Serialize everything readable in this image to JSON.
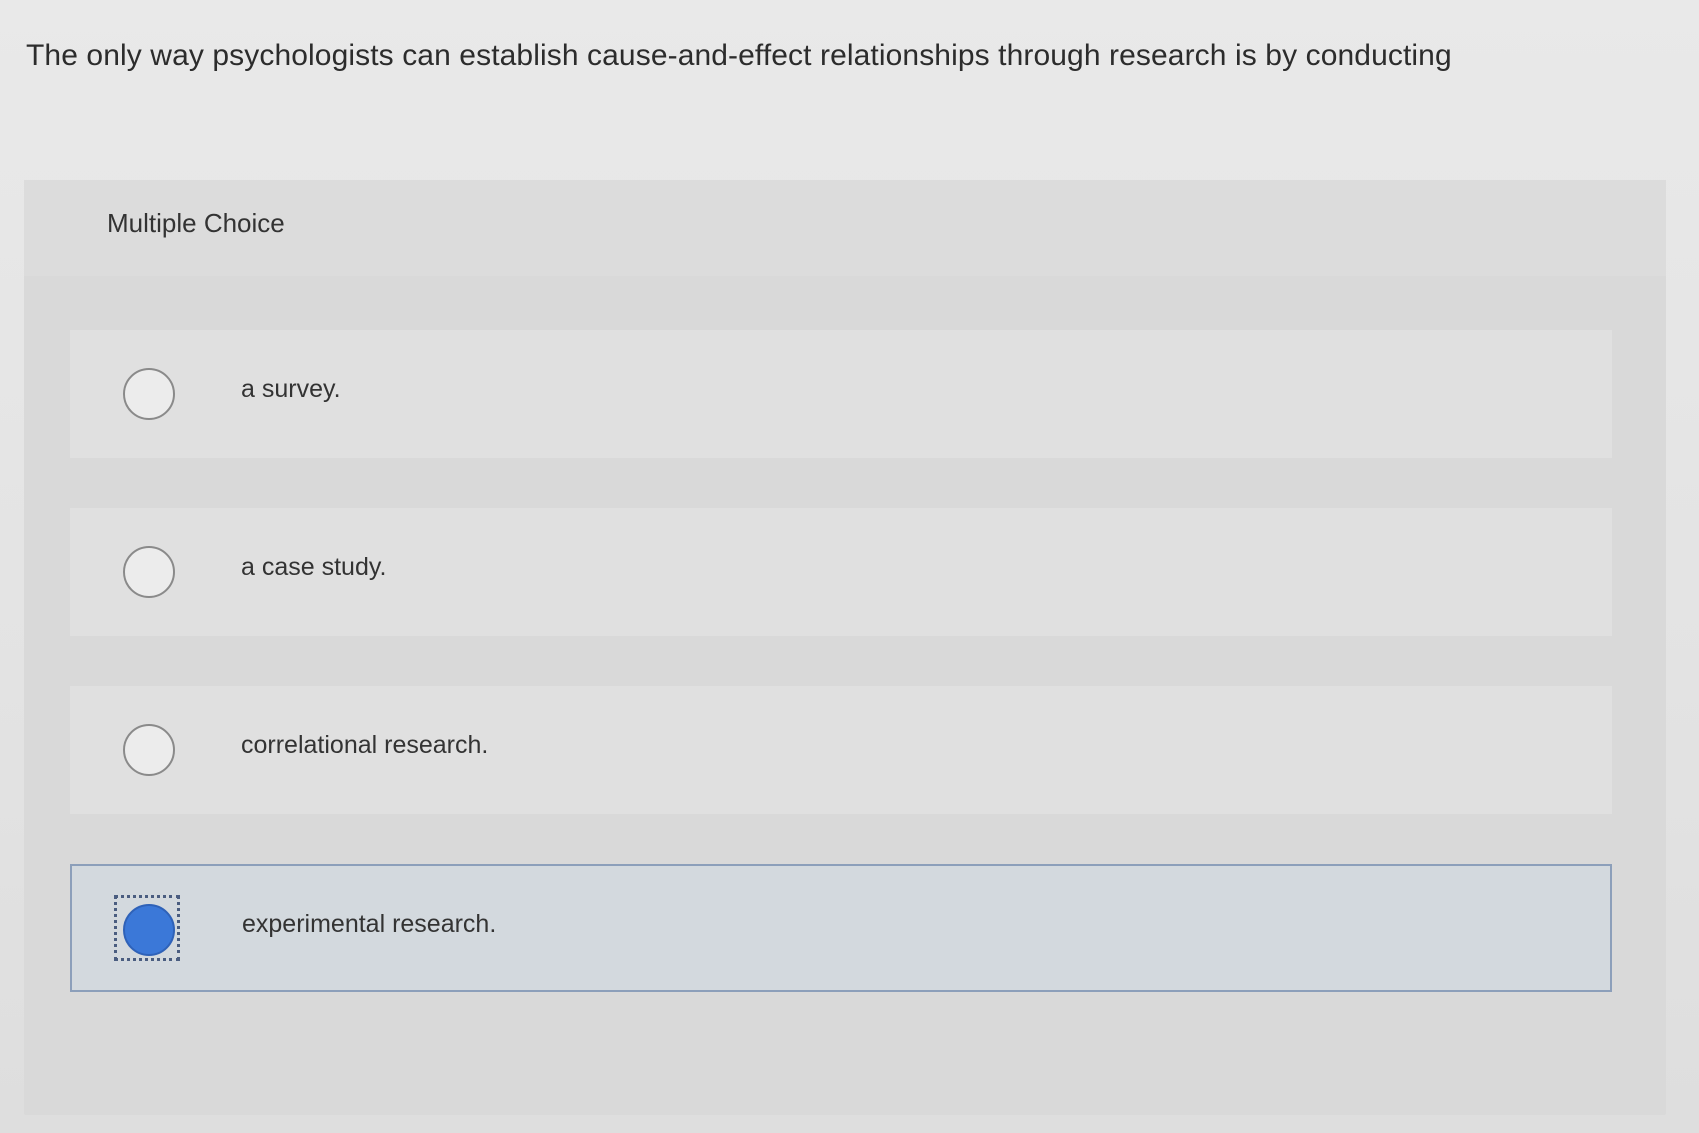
{
  "question": {
    "text": "The only way psychologists can establish cause-and-effect relationships through research is by conducting"
  },
  "panel": {
    "title": "Multiple Choice"
  },
  "options": [
    {
      "label": "a survey.",
      "selected": false
    },
    {
      "label": "a case study.",
      "selected": false
    },
    {
      "label": "correlational research.",
      "selected": false
    },
    {
      "label": "experimental research.",
      "selected": true
    }
  ],
  "colors": {
    "selected_radio": "#3b78d8",
    "selected_border": "#8c9fba",
    "selected_background": "#d3d9de"
  }
}
